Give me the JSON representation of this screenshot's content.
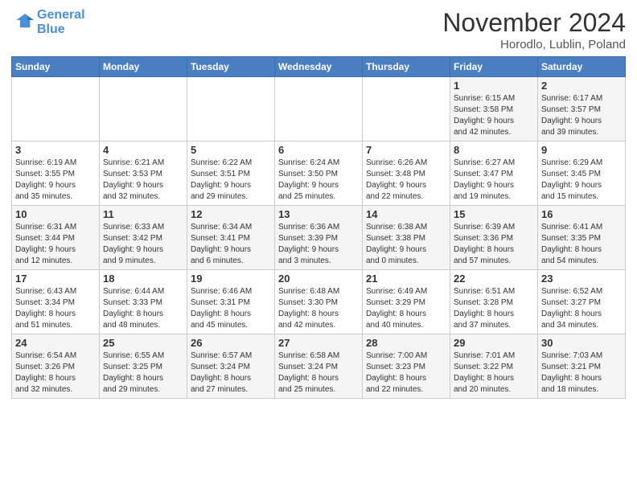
{
  "header": {
    "logo_line1": "General",
    "logo_line2": "Blue",
    "month_title": "November 2024",
    "location": "Horodlo, Lublin, Poland"
  },
  "weekdays": [
    "Sunday",
    "Monday",
    "Tuesday",
    "Wednesday",
    "Thursday",
    "Friday",
    "Saturday"
  ],
  "weeks": [
    [
      {
        "day": "",
        "info": ""
      },
      {
        "day": "",
        "info": ""
      },
      {
        "day": "",
        "info": ""
      },
      {
        "day": "",
        "info": ""
      },
      {
        "day": "",
        "info": ""
      },
      {
        "day": "1",
        "info": "Sunrise: 6:15 AM\nSunset: 3:58 PM\nDaylight: 9 hours\nand 42 minutes."
      },
      {
        "day": "2",
        "info": "Sunrise: 6:17 AM\nSunset: 3:57 PM\nDaylight: 9 hours\nand 39 minutes."
      }
    ],
    [
      {
        "day": "3",
        "info": "Sunrise: 6:19 AM\nSunset: 3:55 PM\nDaylight: 9 hours\nand 35 minutes."
      },
      {
        "day": "4",
        "info": "Sunrise: 6:21 AM\nSunset: 3:53 PM\nDaylight: 9 hours\nand 32 minutes."
      },
      {
        "day": "5",
        "info": "Sunrise: 6:22 AM\nSunset: 3:51 PM\nDaylight: 9 hours\nand 29 minutes."
      },
      {
        "day": "6",
        "info": "Sunrise: 6:24 AM\nSunset: 3:50 PM\nDaylight: 9 hours\nand 25 minutes."
      },
      {
        "day": "7",
        "info": "Sunrise: 6:26 AM\nSunset: 3:48 PM\nDaylight: 9 hours\nand 22 minutes."
      },
      {
        "day": "8",
        "info": "Sunrise: 6:27 AM\nSunset: 3:47 PM\nDaylight: 9 hours\nand 19 minutes."
      },
      {
        "day": "9",
        "info": "Sunrise: 6:29 AM\nSunset: 3:45 PM\nDaylight: 9 hours\nand 15 minutes."
      }
    ],
    [
      {
        "day": "10",
        "info": "Sunrise: 6:31 AM\nSunset: 3:44 PM\nDaylight: 9 hours\nand 12 minutes."
      },
      {
        "day": "11",
        "info": "Sunrise: 6:33 AM\nSunset: 3:42 PM\nDaylight: 9 hours\nand 9 minutes."
      },
      {
        "day": "12",
        "info": "Sunrise: 6:34 AM\nSunset: 3:41 PM\nDaylight: 9 hours\nand 6 minutes."
      },
      {
        "day": "13",
        "info": "Sunrise: 6:36 AM\nSunset: 3:39 PM\nDaylight: 9 hours\nand 3 minutes."
      },
      {
        "day": "14",
        "info": "Sunrise: 6:38 AM\nSunset: 3:38 PM\nDaylight: 9 hours\nand 0 minutes."
      },
      {
        "day": "15",
        "info": "Sunrise: 6:39 AM\nSunset: 3:36 PM\nDaylight: 8 hours\nand 57 minutes."
      },
      {
        "day": "16",
        "info": "Sunrise: 6:41 AM\nSunset: 3:35 PM\nDaylight: 8 hours\nand 54 minutes."
      }
    ],
    [
      {
        "day": "17",
        "info": "Sunrise: 6:43 AM\nSunset: 3:34 PM\nDaylight: 8 hours\nand 51 minutes."
      },
      {
        "day": "18",
        "info": "Sunrise: 6:44 AM\nSunset: 3:33 PM\nDaylight: 8 hours\nand 48 minutes."
      },
      {
        "day": "19",
        "info": "Sunrise: 6:46 AM\nSunset: 3:31 PM\nDaylight: 8 hours\nand 45 minutes."
      },
      {
        "day": "20",
        "info": "Sunrise: 6:48 AM\nSunset: 3:30 PM\nDaylight: 8 hours\nand 42 minutes."
      },
      {
        "day": "21",
        "info": "Sunrise: 6:49 AM\nSunset: 3:29 PM\nDaylight: 8 hours\nand 40 minutes."
      },
      {
        "day": "22",
        "info": "Sunrise: 6:51 AM\nSunset: 3:28 PM\nDaylight: 8 hours\nand 37 minutes."
      },
      {
        "day": "23",
        "info": "Sunrise: 6:52 AM\nSunset: 3:27 PM\nDaylight: 8 hours\nand 34 minutes."
      }
    ],
    [
      {
        "day": "24",
        "info": "Sunrise: 6:54 AM\nSunset: 3:26 PM\nDaylight: 8 hours\nand 32 minutes."
      },
      {
        "day": "25",
        "info": "Sunrise: 6:55 AM\nSunset: 3:25 PM\nDaylight: 8 hours\nand 29 minutes."
      },
      {
        "day": "26",
        "info": "Sunrise: 6:57 AM\nSunset: 3:24 PM\nDaylight: 8 hours\nand 27 minutes."
      },
      {
        "day": "27",
        "info": "Sunrise: 6:58 AM\nSunset: 3:24 PM\nDaylight: 8 hours\nand 25 minutes."
      },
      {
        "day": "28",
        "info": "Sunrise: 7:00 AM\nSunset: 3:23 PM\nDaylight: 8 hours\nand 22 minutes."
      },
      {
        "day": "29",
        "info": "Sunrise: 7:01 AM\nSunset: 3:22 PM\nDaylight: 8 hours\nand 20 minutes."
      },
      {
        "day": "30",
        "info": "Sunrise: 7:03 AM\nSunset: 3:21 PM\nDaylight: 8 hours\nand 18 minutes."
      }
    ]
  ]
}
